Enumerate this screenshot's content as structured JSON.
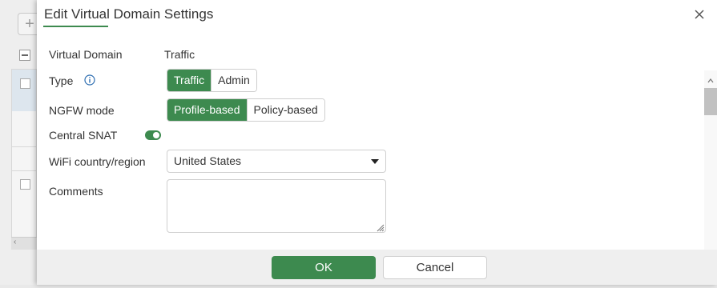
{
  "dialog": {
    "title": "Edit Virtual Domain Settings"
  },
  "form": {
    "virtual_domain": {
      "label": "Virtual Domain",
      "value": "Traffic"
    },
    "type": {
      "label": "Type",
      "options": [
        "Traffic",
        "Admin"
      ],
      "selected": "Traffic"
    },
    "ngfw_mode": {
      "label": "NGFW mode",
      "options": [
        "Profile-based",
        "Policy-based"
      ],
      "selected": "Profile-based"
    },
    "central_snat": {
      "label": "Central SNAT",
      "enabled": true
    },
    "wifi_region": {
      "label": "WiFi country/region",
      "value": "United States"
    },
    "comments": {
      "label": "Comments",
      "value": ""
    }
  },
  "footer": {
    "ok_label": "OK",
    "cancel_label": "Cancel"
  },
  "colors": {
    "accent": "#3d8a4f",
    "footer_bg": "#efefef"
  },
  "icons": {
    "close": "close-icon",
    "info": "info-icon",
    "dropdown": "chevron-down-icon"
  }
}
